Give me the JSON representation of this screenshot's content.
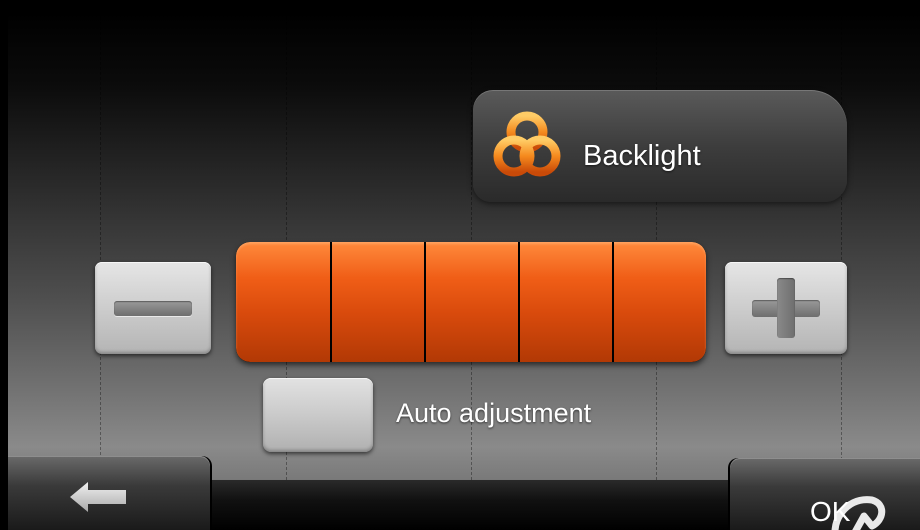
{
  "header": {
    "title": "Backlight",
    "icon": "knot-logo-icon"
  },
  "backlight": {
    "level": 5,
    "max_level": 5,
    "decrease_icon": "minus-icon",
    "increase_icon": "plus-icon"
  },
  "auto_adjust": {
    "label": "Auto adjustment",
    "checked": false
  },
  "footer": {
    "back_icon": "back-arrow-icon",
    "ok_label": "OK"
  },
  "colors": {
    "accent": "#e8561a",
    "button_gray": "#cfcfcf"
  }
}
